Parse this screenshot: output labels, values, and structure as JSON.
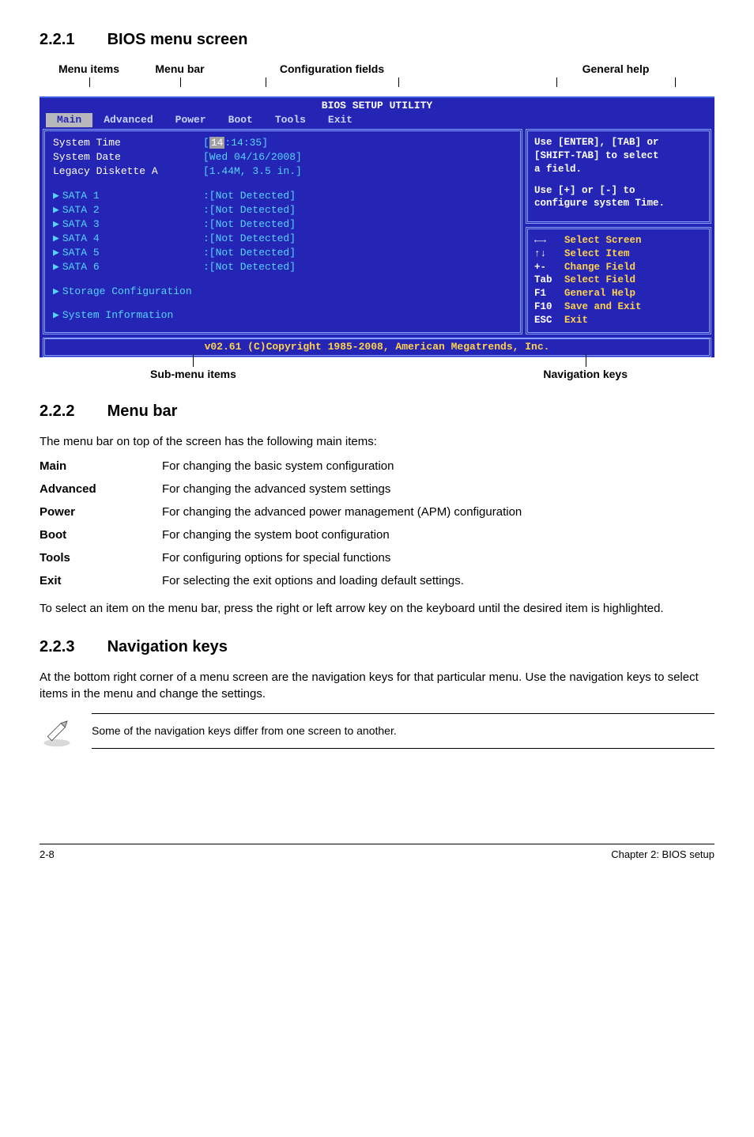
{
  "sections": {
    "s1": {
      "num": "2.2.1",
      "title": "BIOS menu screen"
    },
    "s2": {
      "num": "2.2.2",
      "title": "Menu bar"
    },
    "s3": {
      "num": "2.2.3",
      "title": "Navigation keys"
    }
  },
  "top_labels": {
    "menu_items": "Menu items",
    "menu_bar": "Menu bar",
    "config_fields": "Configuration fields",
    "general_help": "General help"
  },
  "bottom_labels": {
    "submenu": "Sub-menu items",
    "navkeys": "Navigation keys"
  },
  "bios": {
    "title": "BIOS SETUP UTILITY",
    "menus": {
      "main": "Main",
      "advanced": "Advanced",
      "power": "Power",
      "boot": "Boot",
      "tools": "Tools",
      "exit": "Exit"
    },
    "left": {
      "system_time": {
        "label": "System Time",
        "hh": "14",
        "rest": ":14:35]"
      },
      "system_date": {
        "label": "System Date",
        "value": "[Wed 04/16/2008]"
      },
      "legacy": {
        "label": "Legacy Diskette A",
        "value": "[1.44M, 3.5 in.]"
      },
      "sata": {
        "s1": {
          "label": "SATA 1",
          "value": ":[Not Detected]"
        },
        "s2": {
          "label": "SATA 2",
          "value": ":[Not Detected]"
        },
        "s3": {
          "label": "SATA 3",
          "value": ":[Not Detected]"
        },
        "s4": {
          "label": "SATA 4",
          "value": ":[Not Detected]"
        },
        "s5": {
          "label": "SATA 5",
          "value": ":[Not Detected]"
        },
        "s6": {
          "label": "SATA 6",
          "value": ":[Not Detected]"
        }
      },
      "storage": "Storage Configuration",
      "sysinfo": "System Information"
    },
    "help": {
      "l1": "Use [ENTER], [TAB] or",
      "l2": "[SHIFT-TAB] to select",
      "l3": "a field.",
      "l4": "Use [+] or [-] to",
      "l5": "configure system Time."
    },
    "nav": {
      "r1": {
        "v": "Select Screen"
      },
      "r2": {
        "v": "Select Item"
      },
      "r3": {
        "k": "+-",
        "v": "Change Field"
      },
      "r4": {
        "k": "Tab",
        "v": "Select Field"
      },
      "r5": {
        "k": "F1",
        "v": "General Help"
      },
      "r6": {
        "k": "F10",
        "v": "Save and Exit"
      },
      "r7": {
        "k": "ESC",
        "v": "Exit"
      }
    },
    "footer": "v02.61 (C)Copyright 1985-2008, American Megatrends, Inc."
  },
  "menu_bar_intro": "The menu bar on top of the screen has the following main items:",
  "menu_bar_items": {
    "main": {
      "k": "Main",
      "v": "For changing the basic system configuration"
    },
    "advanced": {
      "k": "Advanced",
      "v": "For changing the advanced system settings"
    },
    "power": {
      "k": "Power",
      "v": "For changing the advanced power management (APM) configuration"
    },
    "boot": {
      "k": "Boot",
      "v": "For changing the system boot configuration"
    },
    "tools": {
      "k": "Tools",
      "v": "For configuring options for special functions"
    },
    "exit": {
      "k": "Exit",
      "v": "For selecting the exit options and loading default settings."
    }
  },
  "menu_bar_outro": "To select an item on the menu bar, press the right or left arrow key on the keyboard until the desired item is highlighted.",
  "navkeys_p": "At the bottom right corner of a menu screen are the navigation keys for that particular menu. Use the navigation keys to select items in the menu and change the settings.",
  "note": "Some of the navigation keys differ from one screen to another.",
  "footer": {
    "left": "2-8",
    "right": "Chapter 2: BIOS setup"
  }
}
